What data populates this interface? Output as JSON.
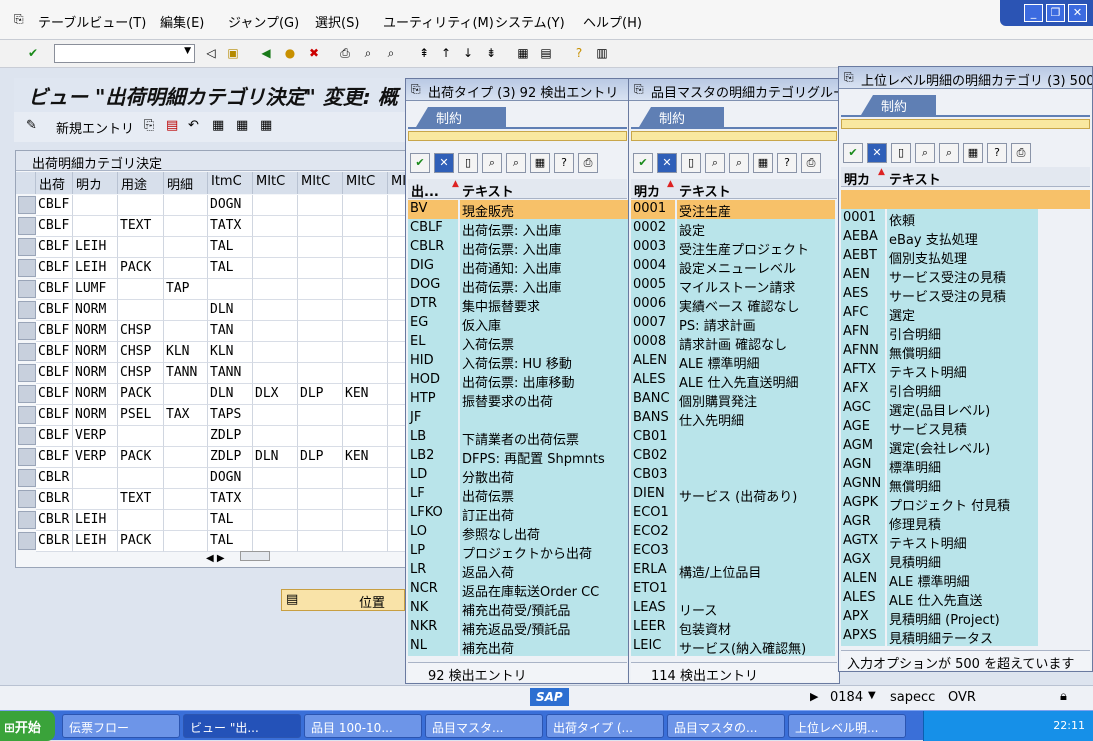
{
  "menubar": {
    "items": [
      "テーブルビュー(T)",
      "編集(E)",
      "ジャンプ(G)",
      "選択(S)",
      "ユーティリティ(M)",
      "システム(Y)",
      "ヘルプ(H)"
    ]
  },
  "main": {
    "title": "ビュー \"出荷明細カテゴリ決定\" 変更: 概",
    "new_entries": "新規エントリ",
    "table_title": "出荷明細カテゴリ決定",
    "columns": [
      "出荷",
      "明カ",
      "用途",
      "明細",
      "ItmC",
      "MItC",
      "MItC",
      "MItC",
      "MI"
    ],
    "rows": [
      [
        "CBLF",
        "",
        "",
        "",
        "DOGN",
        "",
        "",
        "",
        ""
      ],
      [
        "CBLF",
        "",
        "TEXT",
        "",
        "TATX",
        "",
        "",
        "",
        ""
      ],
      [
        "CBLF",
        "LEIH",
        "",
        "",
        "TAL",
        "",
        "",
        "",
        ""
      ],
      [
        "CBLF",
        "LEIH",
        "PACK",
        "",
        "TAL",
        "",
        "",
        "",
        ""
      ],
      [
        "CBLF",
        "LUMF",
        "",
        "TAP",
        "",
        "",
        "",
        "",
        ""
      ],
      [
        "CBLF",
        "NORM",
        "",
        "",
        "DLN",
        "",
        "",
        "",
        ""
      ],
      [
        "CBLF",
        "NORM",
        "CHSP",
        "",
        "TAN",
        "",
        "",
        "",
        ""
      ],
      [
        "CBLF",
        "NORM",
        "CHSP",
        "KLN",
        "KLN",
        "",
        "",
        "",
        ""
      ],
      [
        "CBLF",
        "NORM",
        "CHSP",
        "TANN",
        "TANN",
        "",
        "",
        "",
        ""
      ],
      [
        "CBLF",
        "NORM",
        "PACK",
        "",
        "DLN",
        "DLX",
        "DLP",
        "KEN",
        ""
      ],
      [
        "CBLF",
        "NORM",
        "PSEL",
        "TAX",
        "TAPS",
        "",
        "",
        "",
        ""
      ],
      [
        "CBLF",
        "VERP",
        "",
        "",
        "ZDLP",
        "",
        "",
        "",
        ""
      ],
      [
        "CBLF",
        "VERP",
        "PACK",
        "",
        "ZDLP",
        "DLN",
        "DLP",
        "KEN",
        ""
      ],
      [
        "CBLR",
        "",
        "",
        "",
        "DOGN",
        "",
        "",
        "",
        ""
      ],
      [
        "CBLR",
        "",
        "TEXT",
        "",
        "TATX",
        "",
        "",
        "",
        ""
      ],
      [
        "CBLR",
        "LEIH",
        "",
        "",
        "TAL",
        "",
        "",
        "",
        ""
      ],
      [
        "CBLR",
        "LEIH",
        "PACK",
        "",
        "TAL",
        "",
        "",
        "",
        ""
      ]
    ],
    "position_label": "位置"
  },
  "popup1": {
    "title": "出荷タイプ (3)   92 検出エントリ",
    "tab": "制約",
    "col1": "出...",
    "col2": "テキスト",
    "rows": [
      [
        "BV",
        "現金販売"
      ],
      [
        "CBLF",
        "出荷伝票: 入出庫"
      ],
      [
        "CBLR",
        "出荷伝票: 入出庫"
      ],
      [
        "DIG",
        "出荷通知: 入出庫"
      ],
      [
        "DOG",
        "出荷伝票: 入出庫"
      ],
      [
        "DTR",
        "集中振替要求"
      ],
      [
        "EG",
        "仮入庫"
      ],
      [
        "EL",
        "入荷伝票"
      ],
      [
        "HID",
        "入荷伝票: HU 移動"
      ],
      [
        "HOD",
        "出荷伝票: 出庫移動"
      ],
      [
        "HTP",
        "振替要求の出荷"
      ],
      [
        "JF",
        ""
      ],
      [
        "LB",
        "下請業者の出荷伝票"
      ],
      [
        "LB2",
        "DFPS: 再配置 Shpmnts"
      ],
      [
        "LD",
        "分散出荷"
      ],
      [
        "LF",
        "出荷伝票"
      ],
      [
        "LFKO",
        "訂正出荷"
      ],
      [
        "LO",
        "参照なし出荷"
      ],
      [
        "LP",
        "プロジェクトから出荷"
      ],
      [
        "LR",
        "返品入荷"
      ],
      [
        "NCR",
        "返品在庫転送Order CC"
      ],
      [
        "NK",
        "補充出荷受/預託品"
      ],
      [
        "NKR",
        "補充返品受/預託品"
      ],
      [
        "NL",
        "補充出荷"
      ]
    ],
    "footer": "92 検出エントリ"
  },
  "popup2": {
    "title": "品目マスタの明細カテゴリグループ",
    "tab": "制約",
    "col1": "明カ",
    "col2": "テキスト",
    "rows": [
      [
        "0001",
        "受注生産"
      ],
      [
        "0002",
        "設定"
      ],
      [
        "0003",
        "受注生産プロジェクト"
      ],
      [
        "0004",
        "設定メニューレベル"
      ],
      [
        "0005",
        "マイルストーン請求"
      ],
      [
        "0006",
        "実績ベース 確認なし"
      ],
      [
        "0007",
        "PS: 請求計画"
      ],
      [
        "0008",
        "請求計画 確認なし"
      ],
      [
        "ALEN",
        "ALE 標準明細"
      ],
      [
        "ALES",
        "ALE 仕入先直送明細"
      ],
      [
        "BANC",
        "個別購買発注"
      ],
      [
        "BANS",
        "仕入先明細"
      ],
      [
        "CB01",
        ""
      ],
      [
        "CB02",
        ""
      ],
      [
        "CB03",
        ""
      ],
      [
        "DIEN",
        "サービス (出荷あり)"
      ],
      [
        "ECO1",
        ""
      ],
      [
        "ECO2",
        ""
      ],
      [
        "ECO3",
        ""
      ],
      [
        "ERLA",
        "構造/上位品目"
      ],
      [
        "ETO1",
        ""
      ],
      [
        "LEAS",
        "リース"
      ],
      [
        "LEER",
        "包装資材"
      ],
      [
        "LEIC",
        "サービス(納入確認無)"
      ]
    ],
    "footer": "114 検出エントリ"
  },
  "popup3": {
    "title": "上位レベル明細の明細カテゴリ (3)   500",
    "tab": "制約",
    "col1": "明カ",
    "col2": "テキスト",
    "rows": [
      [
        "",
        ""
      ],
      [
        "0001",
        "依頼"
      ],
      [
        "AEBA",
        "eBay 支払処理"
      ],
      [
        "AEBT",
        "個別支払処理"
      ],
      [
        "AEN",
        "サービス受注の見積"
      ],
      [
        "AES",
        "サービス受注の見積"
      ],
      [
        "AFC",
        "選定"
      ],
      [
        "AFN",
        "引合明細"
      ],
      [
        "AFNN",
        "無償明細"
      ],
      [
        "AFTX",
        "テキスト明細"
      ],
      [
        "AFX",
        "引合明細"
      ],
      [
        "AGC",
        "選定(品目レベル)"
      ],
      [
        "AGE",
        "サービス見積"
      ],
      [
        "AGM",
        "選定(会社レベル)"
      ],
      [
        "AGN",
        "標準明細"
      ],
      [
        "AGNN",
        "無償明細"
      ],
      [
        "AGPK",
        "プロジェクト 付見積"
      ],
      [
        "AGR",
        "修理見積"
      ],
      [
        "AGTX",
        "テキスト明細"
      ],
      [
        "AGX",
        "見積明細"
      ],
      [
        "ALEN",
        "ALE 標準明細"
      ],
      [
        "ALES",
        "ALE 仕入先直送"
      ],
      [
        "APX",
        "見積明細 (Project)"
      ],
      [
        "APXS",
        "見積明細テータス"
      ]
    ],
    "footer": "入力オプションが 500 を超えています"
  },
  "status": {
    "session": "0184",
    "server": "sapecc",
    "mode": "OVR"
  },
  "taskbar": {
    "start": "开始",
    "tasks": [
      "伝票フロー",
      "ビュー \"出...",
      "品目 100-10...",
      "品目マスタ...",
      "出荷タイプ (...",
      "品目マスタの...",
      "上位レベル明..."
    ],
    "clock": "22:11"
  },
  "colors": {
    "accent": "#5f7fb4",
    "selected_row": "#f7c169",
    "cyan_rows": "#b9e4ea"
  }
}
